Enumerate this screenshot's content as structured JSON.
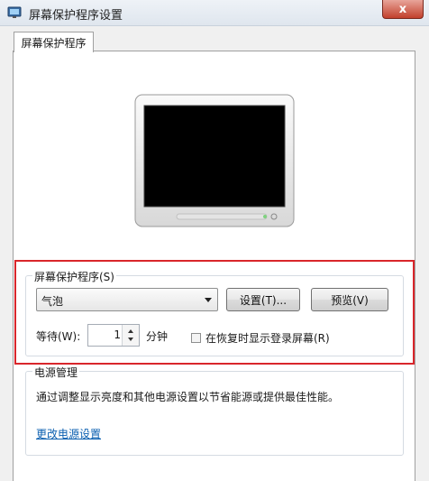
{
  "window": {
    "title": "屏幕保护程序设置",
    "close_label": "x"
  },
  "tab": {
    "label": "屏幕保护程序"
  },
  "screensaver": {
    "group_label": "屏幕保护程序(S)",
    "selected": "气泡",
    "settings_button": "设置(T)...",
    "preview_button": "预览(V)",
    "wait_label": "等待(W):",
    "wait_value": "1",
    "wait_unit": "分钟",
    "resume_checkbox_label": "在恢复时显示登录屏幕(R)",
    "resume_checked": false
  },
  "power": {
    "group_label": "电源管理",
    "description": "通过调整显示亮度和其他电源设置以节省能源或提供最佳性能。",
    "link": "更改电源设置"
  },
  "colors": {
    "highlight": "#d9262b",
    "link": "#0b5fb0",
    "close_button": "#c2402c"
  }
}
